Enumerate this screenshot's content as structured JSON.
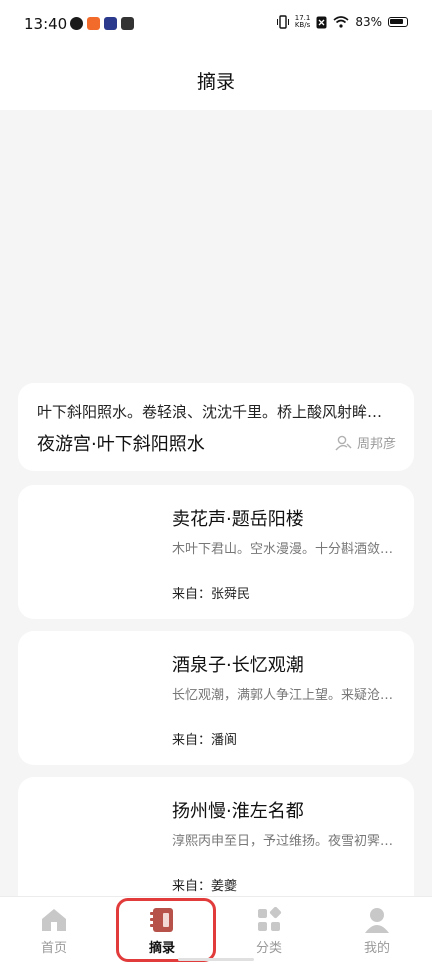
{
  "status_bar": {
    "time": "13:40",
    "speed_top": "17.1",
    "speed_bottom": "KB/s",
    "battery": "83%"
  },
  "header": {
    "title": "摘录"
  },
  "feature": {
    "excerpt": "叶下斜阳照水。卷轻浪、沈沈千里。桥上酸风射眸子。立多时，看黄昏，灯火市。",
    "title": "夜游宫·叶下斜阳照水",
    "author": "周邦彦"
  },
  "cards": [
    {
      "title": "卖花声·题岳阳楼",
      "excerpt": "木叶下君山。空水漫漫。十分斟酒敛芳颜。",
      "from": "来自：张舜民"
    },
    {
      "title": "酒泉子·长忆观潮",
      "excerpt": "长忆观潮，满郭人争江上望。来疑沧海尽成空。",
      "from": "来自：潘阆"
    },
    {
      "title": "扬州慢·淮左名都",
      "excerpt": "淳熙丙申至日，予过维扬。夜雪初霁，荠麦弥望。",
      "from": "来自：姜夔"
    }
  ],
  "nav": [
    {
      "label": "首页",
      "icon": "home-icon"
    },
    {
      "label": "摘录",
      "icon": "notebook-icon"
    },
    {
      "label": "分类",
      "icon": "grid-icon"
    },
    {
      "label": "我的",
      "icon": "user-icon"
    }
  ],
  "colors": {
    "accent": "#b6524a",
    "highlight": "#e23b3b",
    "muted": "#9a9a9a"
  }
}
